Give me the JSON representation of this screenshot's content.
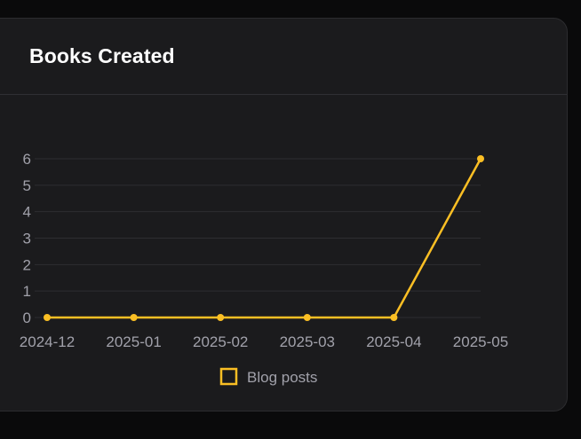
{
  "card": {
    "title": "Books Created"
  },
  "colors": {
    "line": "#fbbf24",
    "grid": "#2e2e31",
    "tick_text": "#a1a1aa",
    "legend_text": "#a1a1aa"
  },
  "chart_data": {
    "type": "line",
    "title": "Books Created",
    "xlabel": "",
    "ylabel": "",
    "categories": [
      "2024-12",
      "2025-01",
      "2025-02",
      "2025-03",
      "2025-04",
      "2025-05"
    ],
    "series": [
      {
        "name": "Blog posts",
        "values": [
          0,
          0,
          0,
          0,
          0,
          6
        ]
      }
    ],
    "ylim": [
      0,
      6
    ],
    "yticks": [
      0,
      1,
      2,
      3,
      4,
      5,
      6
    ],
    "grid": true,
    "legend": "bottom"
  }
}
